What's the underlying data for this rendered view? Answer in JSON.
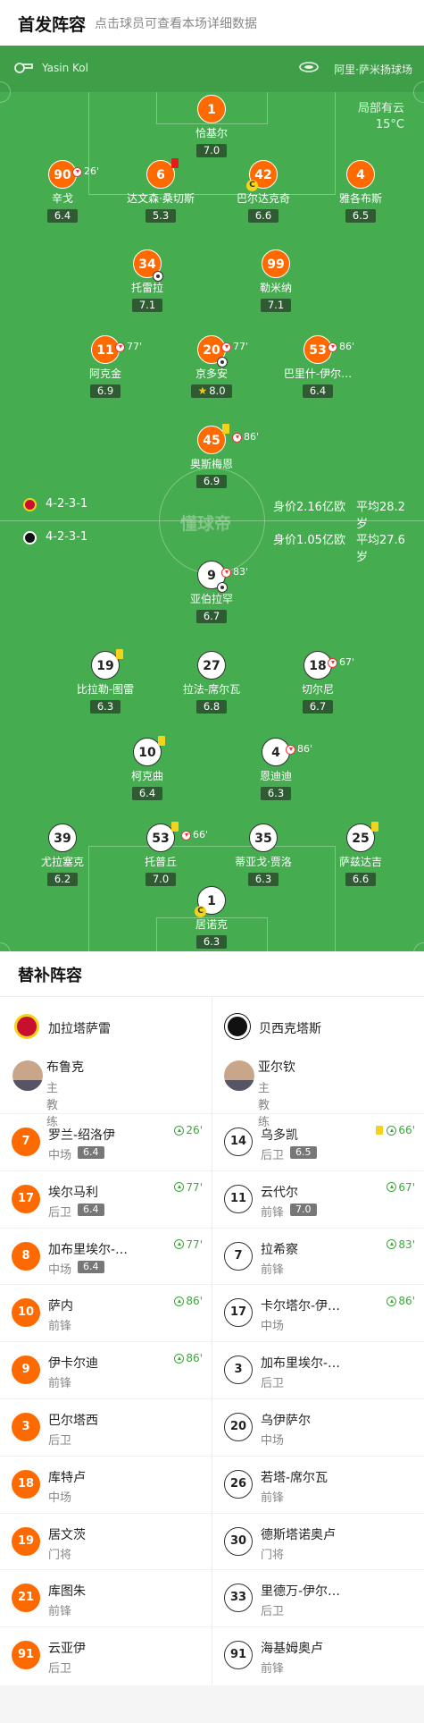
{
  "header": {
    "title": "首发阵容",
    "hint": "点击球员可查看本场详细数据"
  },
  "match": {
    "referee": "Yasin Kol",
    "stadium": "阿里·萨米扬球场",
    "weather": "局部有云",
    "temperature": "15°C",
    "watermark": "懂球帝"
  },
  "home": {
    "name": "加拉塔萨雷",
    "formation": "4-2-3-1",
    "value": "身价2.16亿欧",
    "avg_age": "平均28.2岁",
    "players": [
      {
        "num": "1",
        "name": "恰基尔",
        "rating": "7.0"
      },
      {
        "num": "90",
        "name": "辛戈",
        "rating": "6.4",
        "sub": "26'"
      },
      {
        "num": "6",
        "name": "达文森·桑切斯",
        "rating": "5.3"
      },
      {
        "num": "42",
        "name": "巴尔达克奇",
        "rating": "6.6"
      },
      {
        "num": "4",
        "name": "雅各布斯",
        "rating": "6.5"
      },
      {
        "num": "34",
        "name": "托雷拉",
        "rating": "7.1"
      },
      {
        "num": "99",
        "name": "勒米纳",
        "rating": "7.1"
      },
      {
        "num": "11",
        "name": "阿克金",
        "rating": "6.9",
        "sub": "77'"
      },
      {
        "num": "20",
        "name": "京多安",
        "rating": "8.0",
        "sub": "77'"
      },
      {
        "num": "53",
        "name": "巴里什-伊尔…",
        "rating": "6.4",
        "sub": "86'"
      },
      {
        "num": "45",
        "name": "奥斯梅恩",
        "rating": "6.9",
        "sub": "86'"
      }
    ],
    "coach": {
      "name": "布鲁克",
      "role": "主教练"
    },
    "subs": [
      {
        "num": "7",
        "name": "罗兰-绍洛伊",
        "pos": "中场",
        "rating": "6.4",
        "min": "26'"
      },
      {
        "num": "17",
        "name": "埃尔马利",
        "pos": "后卫",
        "rating": "6.4",
        "min": "77'"
      },
      {
        "num": "8",
        "name": "加布里埃尔-…",
        "pos": "中场",
        "rating": "6.4",
        "min": "77'"
      },
      {
        "num": "10",
        "name": "萨内",
        "pos": "前锋",
        "min": "86'"
      },
      {
        "num": "9",
        "name": "伊卡尔迪",
        "pos": "前锋",
        "min": "86'"
      },
      {
        "num": "3",
        "name": "巴尔塔西",
        "pos": "后卫"
      },
      {
        "num": "18",
        "name": "库特卢",
        "pos": "中场"
      },
      {
        "num": "19",
        "name": "居文茨",
        "pos": "门将"
      },
      {
        "num": "21",
        "name": "库图朱",
        "pos": "前锋"
      },
      {
        "num": "91",
        "name": "云亚伊",
        "pos": "后卫"
      }
    ]
  },
  "away": {
    "name": "贝西克塔斯",
    "formation": "4-2-3-1",
    "value": "身价1.05亿欧",
    "avg_age": "平均27.6岁",
    "players": [
      {
        "num": "9",
        "name": "亚伯拉罕",
        "rating": "6.7",
        "sub": "83'"
      },
      {
        "num": "19",
        "name": "比拉勒-图雷",
        "rating": "6.3"
      },
      {
        "num": "27",
        "name": "拉法-席尔瓦",
        "rating": "6.8"
      },
      {
        "num": "18",
        "name": "切尔尼",
        "rating": "6.7",
        "sub": "67'"
      },
      {
        "num": "10",
        "name": "柯克曲",
        "rating": "6.4"
      },
      {
        "num": "4",
        "name": "恩迪迪",
        "rating": "6.3",
        "sub": "86'"
      },
      {
        "num": "39",
        "name": "尤拉塞克",
        "rating": "6.2"
      },
      {
        "num": "53",
        "name": "托普丘",
        "rating": "7.0",
        "sub": "66'"
      },
      {
        "num": "35",
        "name": "蒂亚戈·贾洛",
        "rating": "6.3"
      },
      {
        "num": "25",
        "name": "萨兹达吉",
        "rating": "6.6"
      },
      {
        "num": "1",
        "name": "居诺克",
        "rating": "6.3"
      }
    ],
    "coach": {
      "name": "亚尔钦",
      "role": "主教练"
    },
    "subs": [
      {
        "num": "14",
        "name": "乌多凯",
        "pos": "后卫",
        "rating": "6.5",
        "min": "66'"
      },
      {
        "num": "11",
        "name": "云代尔",
        "pos": "前锋",
        "rating": "7.0",
        "min": "67'"
      },
      {
        "num": "7",
        "name": "拉希察",
        "pos": "前锋",
        "min": "83'"
      },
      {
        "num": "17",
        "name": "卡尔塔尔-伊…",
        "pos": "中场",
        "min": "86'"
      },
      {
        "num": "3",
        "name": "加布里埃尔-…",
        "pos": "后卫"
      },
      {
        "num": "20",
        "name": "乌伊萨尔",
        "pos": "中场"
      },
      {
        "num": "26",
        "name": "若塔-席尔瓦",
        "pos": "前锋"
      },
      {
        "num": "30",
        "name": "德斯塔诺奥卢",
        "pos": "门将"
      },
      {
        "num": "33",
        "name": "里德万-伊尔…",
        "pos": "后卫"
      },
      {
        "num": "91",
        "name": "海基姆奥卢",
        "pos": "前锋"
      }
    ]
  },
  "subs_title": "替补阵容",
  "colors": {
    "pitch": "#45ac4f",
    "home": "#ff6a00",
    "rating_bg": "#2f5b33",
    "sub_up": "#3aa83a",
    "yellow": "#f3d31b",
    "red": "#e51b1b"
  }
}
